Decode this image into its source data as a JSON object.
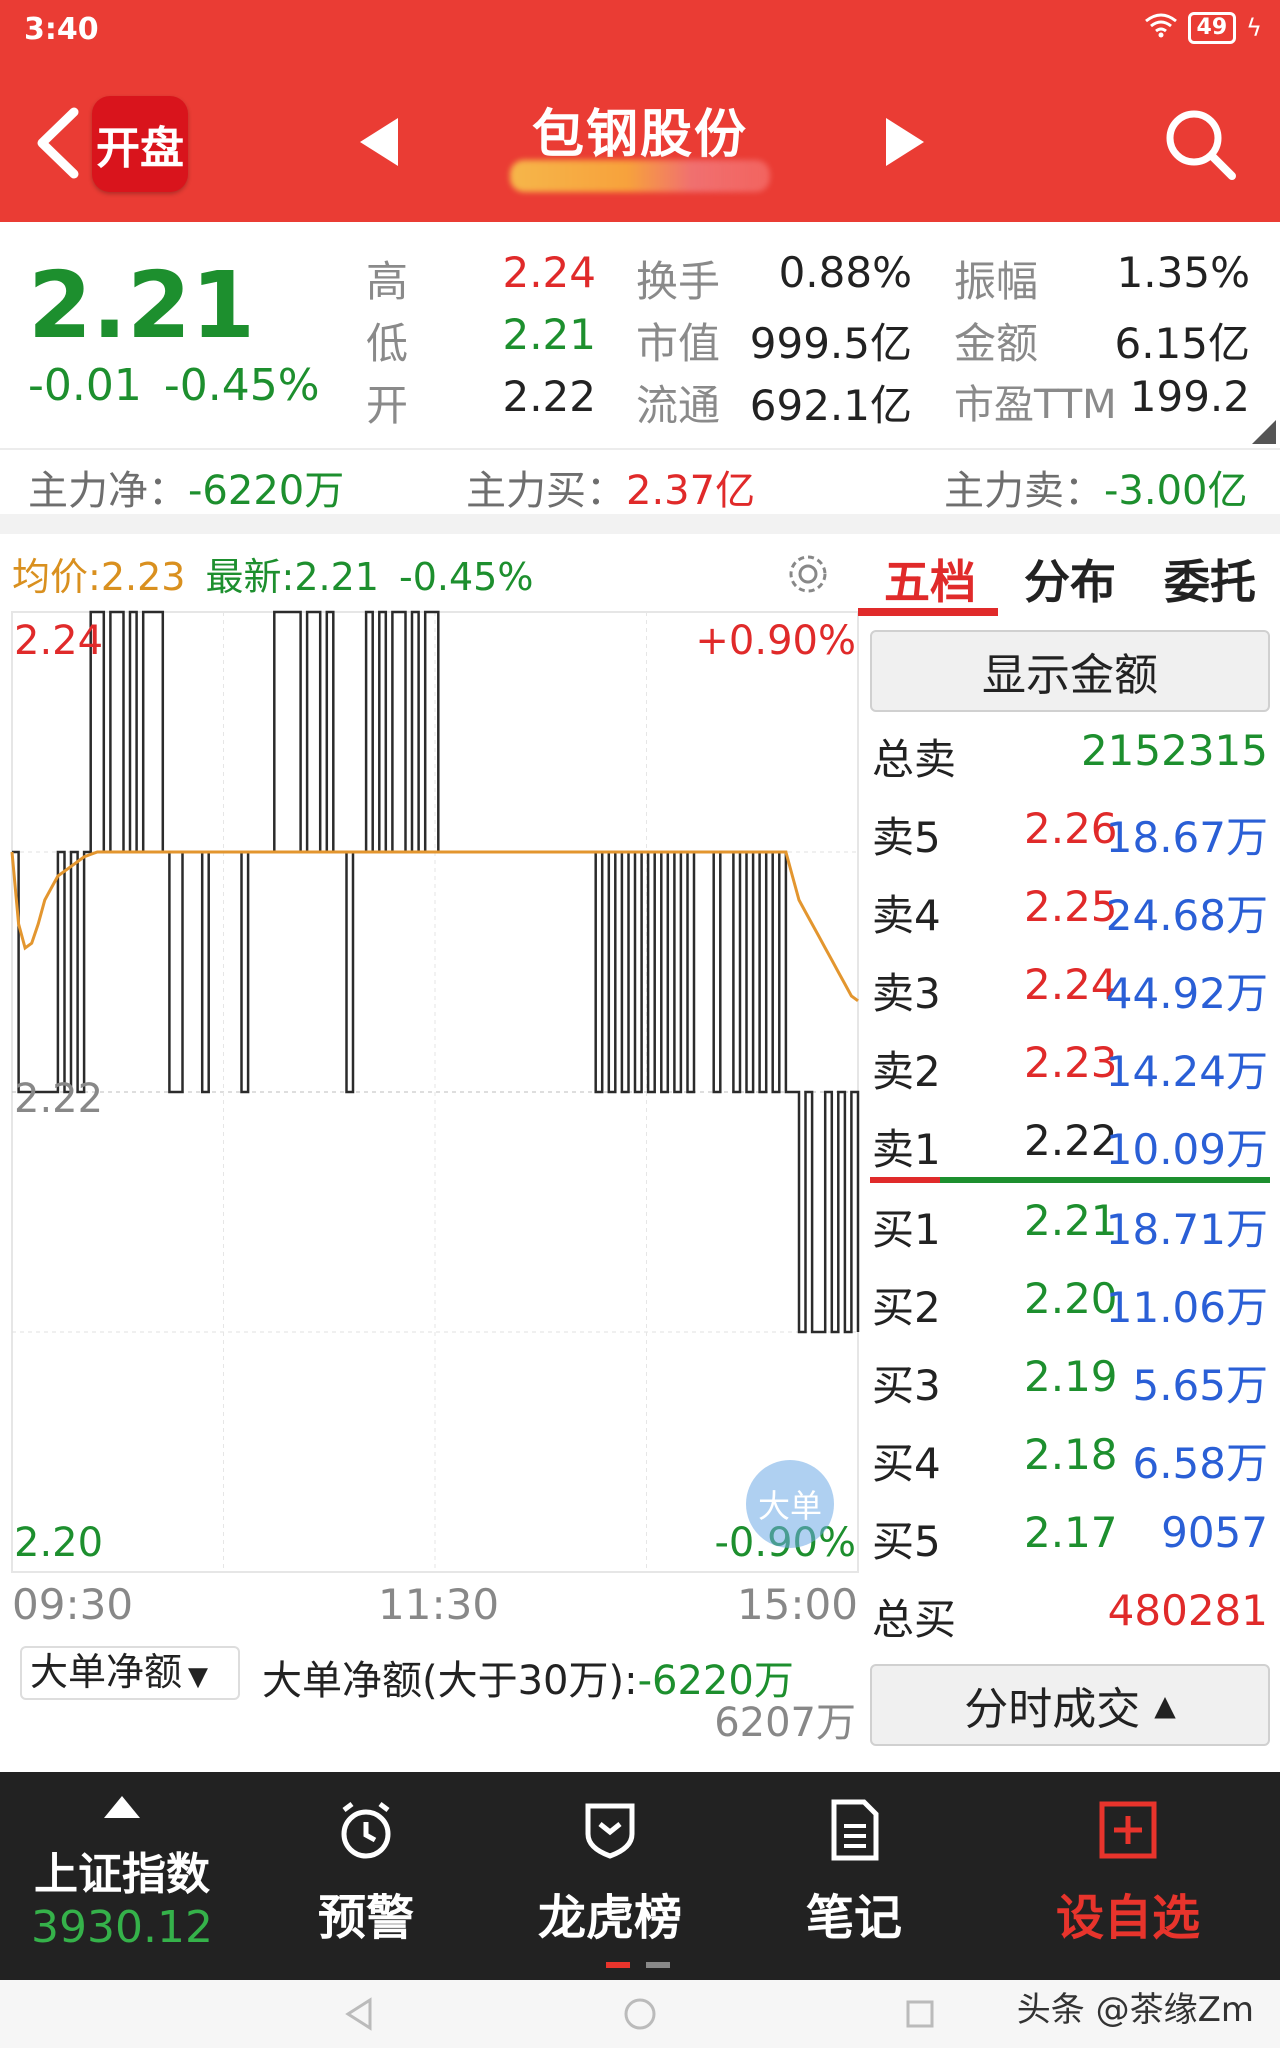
{
  "status": {
    "time": "3:40",
    "battery": "49"
  },
  "header": {
    "logo_text": "开盘",
    "stock_name": "包钢股份",
    "colors": {
      "header_bg": "#ea3c34",
      "up": "#e02a2a",
      "down": "#1d8f2e",
      "avg_line": "#e3962f"
    }
  },
  "quote": {
    "last_price": "2.21",
    "change": "-0.01",
    "change_pct": "-0.45%",
    "high_label": "高",
    "high": "2.24",
    "low_label": "低",
    "low": "2.21",
    "open_label": "开",
    "open": "2.22",
    "turnover_label": "换手",
    "turnover": "0.88%",
    "mktcap_label": "市值",
    "mktcap": "999.5亿",
    "float_label": "流通",
    "float": "692.1亿",
    "amplitude_label": "振幅",
    "amplitude": "1.35%",
    "amount_label": "金额",
    "amount": "6.15亿",
    "pe_label": "市盈TTM",
    "pe": "199.2"
  },
  "flow": {
    "net_label": "主力净：",
    "net": "-6220万",
    "buy_label": "主力买：",
    "buy": "2.37亿",
    "sell_label": "主力卖：",
    "sell": "-3.00亿"
  },
  "chart_head": {
    "avg_label": "均价:",
    "avg": "2.23",
    "last_label": "最新:",
    "last": "2.21",
    "pct": "-0.45%"
  },
  "chart_data": {
    "type": "line",
    "ylim": [
      2.2,
      2.24
    ],
    "y_tick_labels": [
      "2.24",
      "2.22",
      "2.20"
    ],
    "pct_labels": [
      "+0.90%",
      "-0.90%"
    ],
    "x_tick_labels": [
      "09:30",
      "11:30",
      "15:00"
    ],
    "series": [
      {
        "name": "最新",
        "values": [
          2.23,
          2.22,
          2.22,
          2.22,
          2.22,
          2.22,
          2.22,
          2.23,
          2.22,
          2.23,
          2.22,
          2.23,
          2.24,
          2.24,
          2.23,
          2.24,
          2.24,
          2.23,
          2.24,
          2.23,
          2.24,
          2.24,
          2.24,
          2.23,
          2.22,
          2.22,
          2.23,
          2.23,
          2.23,
          2.22,
          2.23,
          2.23,
          2.23,
          2.23,
          2.23,
          2.22,
          2.23,
          2.23,
          2.23,
          2.23,
          2.24,
          2.24,
          2.24,
          2.24,
          2.23,
          2.24,
          2.24,
          2.23,
          2.24,
          2.23,
          2.23,
          2.22,
          2.23,
          2.23,
          2.24,
          2.23,
          2.24,
          2.23,
          2.24,
          2.24,
          2.23,
          2.24,
          2.23,
          2.24,
          2.24,
          2.23,
          2.23,
          2.23,
          2.23,
          2.23,
          2.23,
          2.23,
          2.23,
          2.23,
          2.23,
          2.23,
          2.23,
          2.23,
          2.23,
          2.23,
          2.23,
          2.23,
          2.23,
          2.23,
          2.23,
          2.23,
          2.23,
          2.23,
          2.23,
          2.22,
          2.23,
          2.22,
          2.23,
          2.22,
          2.23,
          2.22,
          2.23,
          2.22,
          2.23,
          2.22,
          2.23,
          2.22,
          2.23,
          2.22,
          2.23,
          2.23,
          2.23,
          2.22,
          2.23,
          2.23,
          2.22,
          2.23,
          2.22,
          2.23,
          2.22,
          2.23,
          2.22,
          2.23,
          2.22,
          2.22,
          2.21,
          2.22,
          2.21,
          2.21,
          2.22,
          2.21,
          2.22,
          2.21,
          2.22,
          2.21
        ]
      },
      {
        "name": "均价",
        "values": [
          2.23,
          2.227,
          2.226,
          2.2262,
          2.227,
          2.228,
          2.2285,
          2.229,
          2.2292,
          2.2294,
          2.2296,
          2.2298,
          2.2299,
          2.23,
          2.23,
          2.23,
          2.23,
          2.23,
          2.23,
          2.23,
          2.23,
          2.23,
          2.23,
          2.23,
          2.23,
          2.23,
          2.23,
          2.23,
          2.23,
          2.23,
          2.23,
          2.23,
          2.23,
          2.23,
          2.23,
          2.23,
          2.23,
          2.23,
          2.23,
          2.23,
          2.23,
          2.23,
          2.23,
          2.23,
          2.23,
          2.23,
          2.23,
          2.23,
          2.23,
          2.23,
          2.23,
          2.23,
          2.23,
          2.23,
          2.23,
          2.23,
          2.23,
          2.23,
          2.23,
          2.23,
          2.23,
          2.23,
          2.23,
          2.23,
          2.23,
          2.23,
          2.23,
          2.23,
          2.23,
          2.23,
          2.23,
          2.23,
          2.23,
          2.23,
          2.23,
          2.23,
          2.23,
          2.23,
          2.23,
          2.23,
          2.23,
          2.23,
          2.23,
          2.23,
          2.23,
          2.23,
          2.23,
          2.23,
          2.23,
          2.23,
          2.23,
          2.23,
          2.23,
          2.23,
          2.23,
          2.23,
          2.23,
          2.23,
          2.23,
          2.23,
          2.23,
          2.23,
          2.23,
          2.23,
          2.23,
          2.23,
          2.23,
          2.23,
          2.23,
          2.23,
          2.23,
          2.23,
          2.23,
          2.23,
          2.23,
          2.23,
          2.23,
          2.23,
          2.23,
          2.229,
          2.228,
          2.2275,
          2.227,
          2.2265,
          2.226,
          2.2255,
          2.225,
          2.2245,
          2.224,
          2.2238
        ]
      }
    ]
  },
  "indicator": {
    "selector": "大单净额",
    "text_label": "大单净额(大于30万):",
    "text_value": "-6220万",
    "right_value": "6207万",
    "badge": "大单"
  },
  "tabs": [
    "五档",
    "分布",
    "委托"
  ],
  "order_book": {
    "show_amount": "显示金额",
    "total_sell_label": "总卖",
    "total_sell": "2152315",
    "asks": [
      {
        "label": "卖5",
        "price": "2.26",
        "vol": "18.67万"
      },
      {
        "label": "卖4",
        "price": "2.25",
        "vol": "24.68万"
      },
      {
        "label": "卖3",
        "price": "2.24",
        "vol": "44.92万"
      },
      {
        "label": "卖2",
        "price": "2.23",
        "vol": "14.24万"
      },
      {
        "label": "卖1",
        "price": "2.22",
        "vol": "10.09万"
      }
    ],
    "bids": [
      {
        "label": "买1",
        "price": "2.21",
        "vol": "18.71万"
      },
      {
        "label": "买2",
        "price": "2.20",
        "vol": "11.06万"
      },
      {
        "label": "买3",
        "price": "2.19",
        "vol": "5.65万"
      },
      {
        "label": "买4",
        "price": "2.18",
        "vol": "6.58万"
      },
      {
        "label": "买5",
        "price": "2.17",
        "vol": "9057"
      }
    ],
    "total_buy_label": "总买",
    "total_buy": "480281",
    "trades_btn": "分时成交"
  },
  "bottom_nav": {
    "index_name": "上证指数",
    "index_value": "3930.12",
    "alert": "预警",
    "dragon": "龙虎榜",
    "notes": "笔记",
    "add_watch": "设自选"
  },
  "watermark": "头条 @茶缘Zm"
}
